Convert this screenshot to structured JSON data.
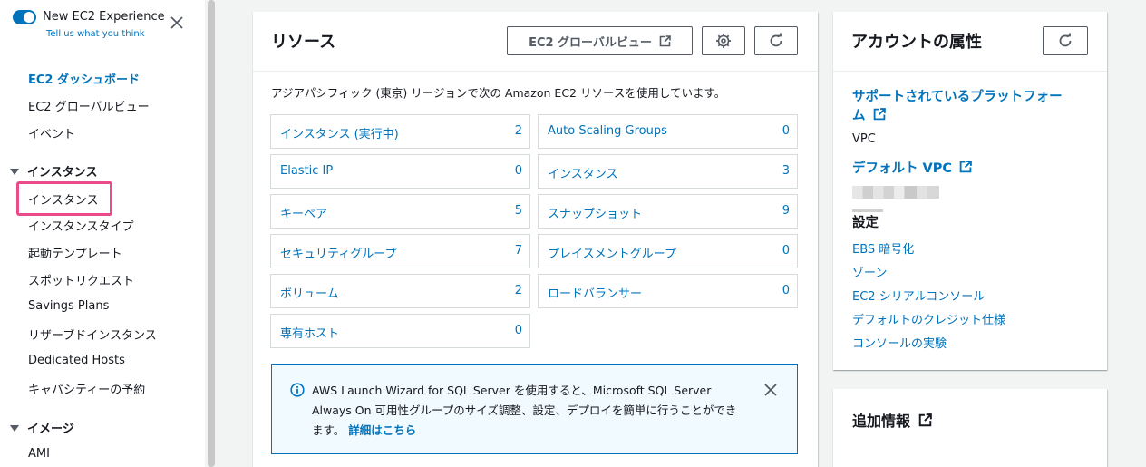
{
  "sidebar": {
    "experience_title": "New EC2 Experience",
    "experience_sub": "Tell us what you think",
    "items": {
      "dashboard": "EC2 ダッシュボード",
      "global_view": "EC2 グローバルビュー",
      "events": "イベント"
    },
    "section_instances": "インスタンス",
    "instances_items": {
      "instances": "インスタンス",
      "instance_types": "インスタンスタイプ",
      "launch_templates": "起動テンプレート",
      "spot_requests": "スポットリクエスト",
      "savings_plans": "Savings Plans",
      "reserved": "リザーブドインスタンス",
      "dedicated_hosts": "Dedicated Hosts",
      "capacity": "キャパシティーの予約"
    },
    "section_images": "イメージ",
    "images_items": {
      "ami": "AMI"
    }
  },
  "resources": {
    "title": "リソース",
    "global_view_btn": "EC2 グローバルビュー",
    "description": "アジアパシフィック (東京) リージョンで次の Amazon EC2 リソースを使用しています。",
    "tiles": [
      {
        "label": "インスタンス (実行中)",
        "count": "2"
      },
      {
        "label": "Auto Scaling Groups",
        "count": "0"
      },
      {
        "label": "Elastic IP",
        "count": "0"
      },
      {
        "label": "インスタンス",
        "count": "3"
      },
      {
        "label": "キーペア",
        "count": "5"
      },
      {
        "label": "スナップショット",
        "count": "9"
      },
      {
        "label": "セキュリティグループ",
        "count": "7"
      },
      {
        "label": "プレイスメントグループ",
        "count": "0"
      },
      {
        "label": "ボリューム",
        "count": "2"
      },
      {
        "label": "ロードバランサー",
        "count": "0"
      },
      {
        "label": "専有ホスト",
        "count": "0"
      }
    ],
    "info": {
      "text": "AWS Launch Wizard for SQL Server を使用すると、Microsoft SQL Server Always On 可用性グループのサイズ調整、設定、デプロイを簡単に行うことができます。",
      "link": "詳細はこちら"
    }
  },
  "account": {
    "title": "アカウントの属性",
    "platforms_line1": "サポートされているプラットフォー",
    "platforms_line2": "ム",
    "platforms_value": "VPC",
    "default_vpc": "デフォルト VPC",
    "settings_heading": "設定",
    "settings": {
      "ebs": "EBS 暗号化",
      "zones": "ゾーン",
      "serial": "EC2 シリアルコンソール",
      "credit": "デフォルトのクレジット仕様",
      "experiments": "コンソールの実験"
    }
  },
  "additional": {
    "title": "追加情報"
  },
  "colors": {
    "accent": "#0073bb",
    "highlight": "#ec4b8b",
    "background": "#f2f3f3"
  }
}
